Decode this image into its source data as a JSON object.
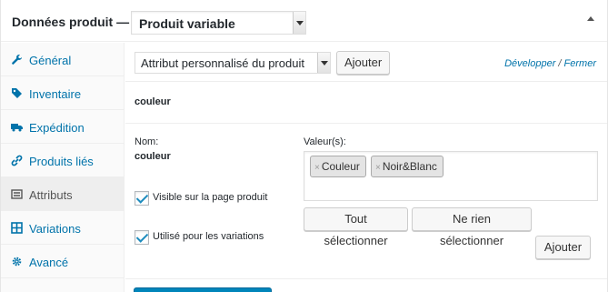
{
  "header": {
    "title": "Données produit —",
    "product_type": "Produit variable"
  },
  "sidebar": {
    "items": [
      {
        "label": "Général",
        "icon": "wrench-icon",
        "glyph": "🔧"
      },
      {
        "label": "Inventaire",
        "icon": "tag-icon",
        "glyph": "◆"
      },
      {
        "label": "Expédition",
        "icon": "truck-icon",
        "glyph": "■"
      },
      {
        "label": "Produits liés",
        "icon": "link-icon",
        "glyph": "∞"
      },
      {
        "label": "Attributs",
        "icon": "list-icon",
        "glyph": "☰"
      },
      {
        "label": "Variations",
        "icon": "grid-icon",
        "glyph": "⊞"
      },
      {
        "label": "Avancé",
        "icon": "gear-icon",
        "glyph": "⚙"
      }
    ],
    "active_index": 4
  },
  "toolbar": {
    "attribute_select": "Attribut personnalisé du produit",
    "add_label": "Ajouter",
    "expand_label": "Développer",
    "separator": "/",
    "close_label": "Fermer"
  },
  "attribute": {
    "heading": "couleur",
    "name_label": "Nom:",
    "name_value": "couleur",
    "values_label": "Valeur(s):",
    "values": [
      "Couleur",
      "Noir&Blanc"
    ],
    "remove_glyph": "×",
    "visible_label": "Visible sur la page produit",
    "variations_label": "Utilisé pour les variations",
    "select_all_label": "Tout sélectionner",
    "select_none_label": "Ne rien sélectionner",
    "add_value_label": "Ajouter"
  },
  "colors": {
    "accent": "#0073aa",
    "primary_button": "#0085ba"
  }
}
